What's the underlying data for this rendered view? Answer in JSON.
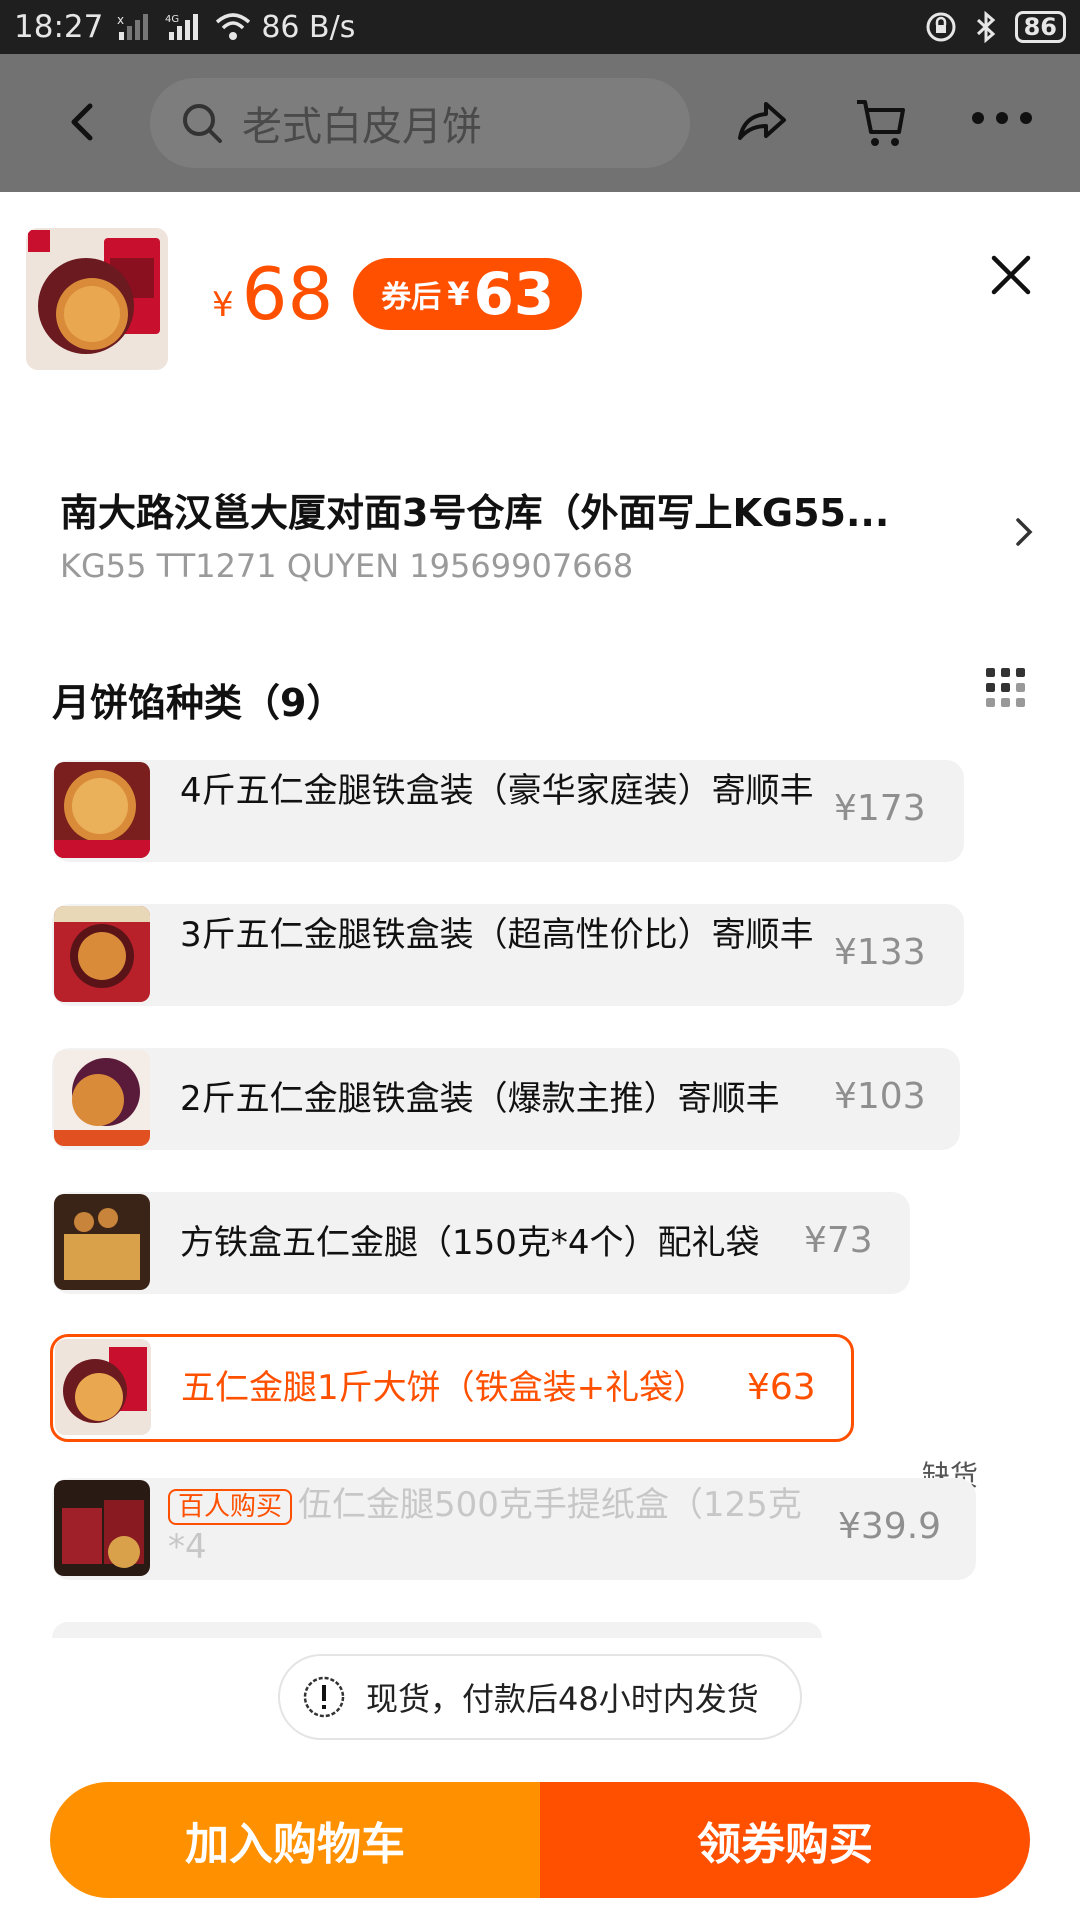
{
  "status_bar": {
    "time": "18:27",
    "network_speed": "86 B/s",
    "battery": "86",
    "network_type": "4G"
  },
  "nav": {
    "search_placeholder": "老式白皮月饼"
  },
  "product": {
    "price_currency": "¥",
    "price": "68",
    "coupon_label": "券后",
    "coupon_currency": "¥",
    "coupon_price": "63"
  },
  "address": {
    "line1": "南大路汉邕大厦对面3号仓库（外面写上KG55...",
    "line2": "KG55 TT1271 QUYEN 19569907668"
  },
  "section": {
    "title": "月饼馅种类（9）"
  },
  "options": [
    {
      "name": "4斤五仁金腿铁盒装（豪华家庭装）寄顺丰",
      "price": "¥173",
      "state": "normal"
    },
    {
      "name": "3斤五仁金腿铁盒装（超高性价比）寄顺丰",
      "price": "¥133",
      "state": "normal"
    },
    {
      "name": "2斤五仁金腿铁盒装（爆款主推）寄顺丰",
      "price": "¥103",
      "state": "normal"
    },
    {
      "name": "方铁盒五仁金腿（150克*4个）配礼袋",
      "price": "¥73",
      "state": "normal"
    },
    {
      "name": "五仁金腿1斤大饼（铁盒装+礼袋）",
      "price": "¥63",
      "state": "selected"
    },
    {
      "tag": "百人购买",
      "name": "伍仁金腿500克手提纸盒（125克*4",
      "price": "¥39.9",
      "state": "disabled",
      "note": "缺货"
    }
  ],
  "shipping_note": "现货，付款后48小时内发货",
  "buttons": {
    "add_to_cart": "加入购物车",
    "buy": "领券购买"
  },
  "colors": {
    "accent": "#ff5000",
    "cart_button": "#ff9000"
  }
}
